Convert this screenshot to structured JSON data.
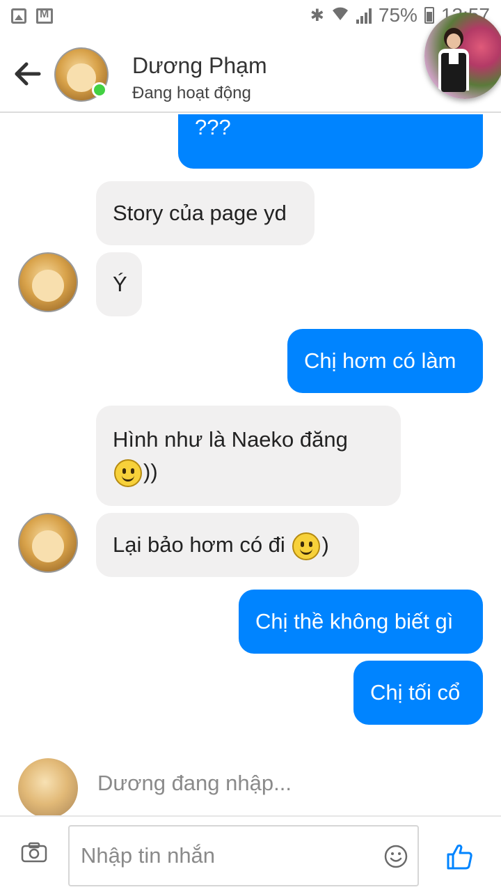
{
  "status_bar": {
    "battery": "75%",
    "time": "13:57",
    "icons": [
      "image-icon",
      "gmail-icon",
      "bluetooth-icon",
      "wifi-icon",
      "signal-icon",
      "battery-icon"
    ]
  },
  "header": {
    "contact_name": "Dương Phạm",
    "contact_status": "Đang hoạt động",
    "accent_online": "#42d142"
  },
  "messages": [
    {
      "side": "out",
      "text": "???"
    },
    {
      "side": "in",
      "text": "Story của page yd"
    },
    {
      "side": "in",
      "text": "Ý"
    },
    {
      "side": "out",
      "text": "Chị hơm có làm"
    },
    {
      "side": "in",
      "text_line1": "Hình như là Naeko đăng",
      "text_line2_suffix": "))"
    },
    {
      "side": "in",
      "text_prefix": "Lại bảo hơm có đi",
      "text_suffix": ")"
    },
    {
      "side": "out",
      "text": "Chị thề không biết gì"
    },
    {
      "side": "out",
      "text": "Chị tối cổ"
    }
  ],
  "typing_indicator": "Dương đang nhập...",
  "composer": {
    "placeholder": "Nhập tin nhắn"
  },
  "colors": {
    "outgoing_bubble": "#0084ff",
    "incoming_bubble": "#f1f0f0",
    "messenger_blue": "#0084ff"
  }
}
